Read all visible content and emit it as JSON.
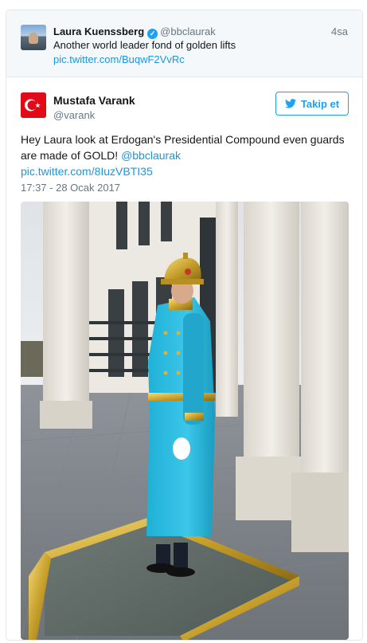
{
  "quoted_tweet": {
    "author_name": "Laura Kuenssberg",
    "verified_icon": "verified-badge-icon",
    "handle": "@bbclaurak",
    "time": "4sa",
    "text": "Another world leader fond of golden lifts",
    "link": "pic.twitter.com/BuqwF2VvRc"
  },
  "tweet": {
    "author_name": "Mustafa Varank",
    "handle": "@varank",
    "follow_label": "Takip et",
    "follow_icon": "twitter-bird-icon",
    "text_prefix": "Hey Laura look at Erdogan's Presidential Compound even guards are made of GOLD! ",
    "mention": "@bbclaurak",
    "pic_link": "pic.twitter.com/8IuzVBTI35",
    "timestamp": "17:37 - 28 Ocak 2017",
    "photo": "ceremonial-guard-photo"
  },
  "colors": {
    "link": "#1b95e0",
    "brand": "#1da1f2",
    "muted": "#657786",
    "flag_red": "#e30a17"
  }
}
